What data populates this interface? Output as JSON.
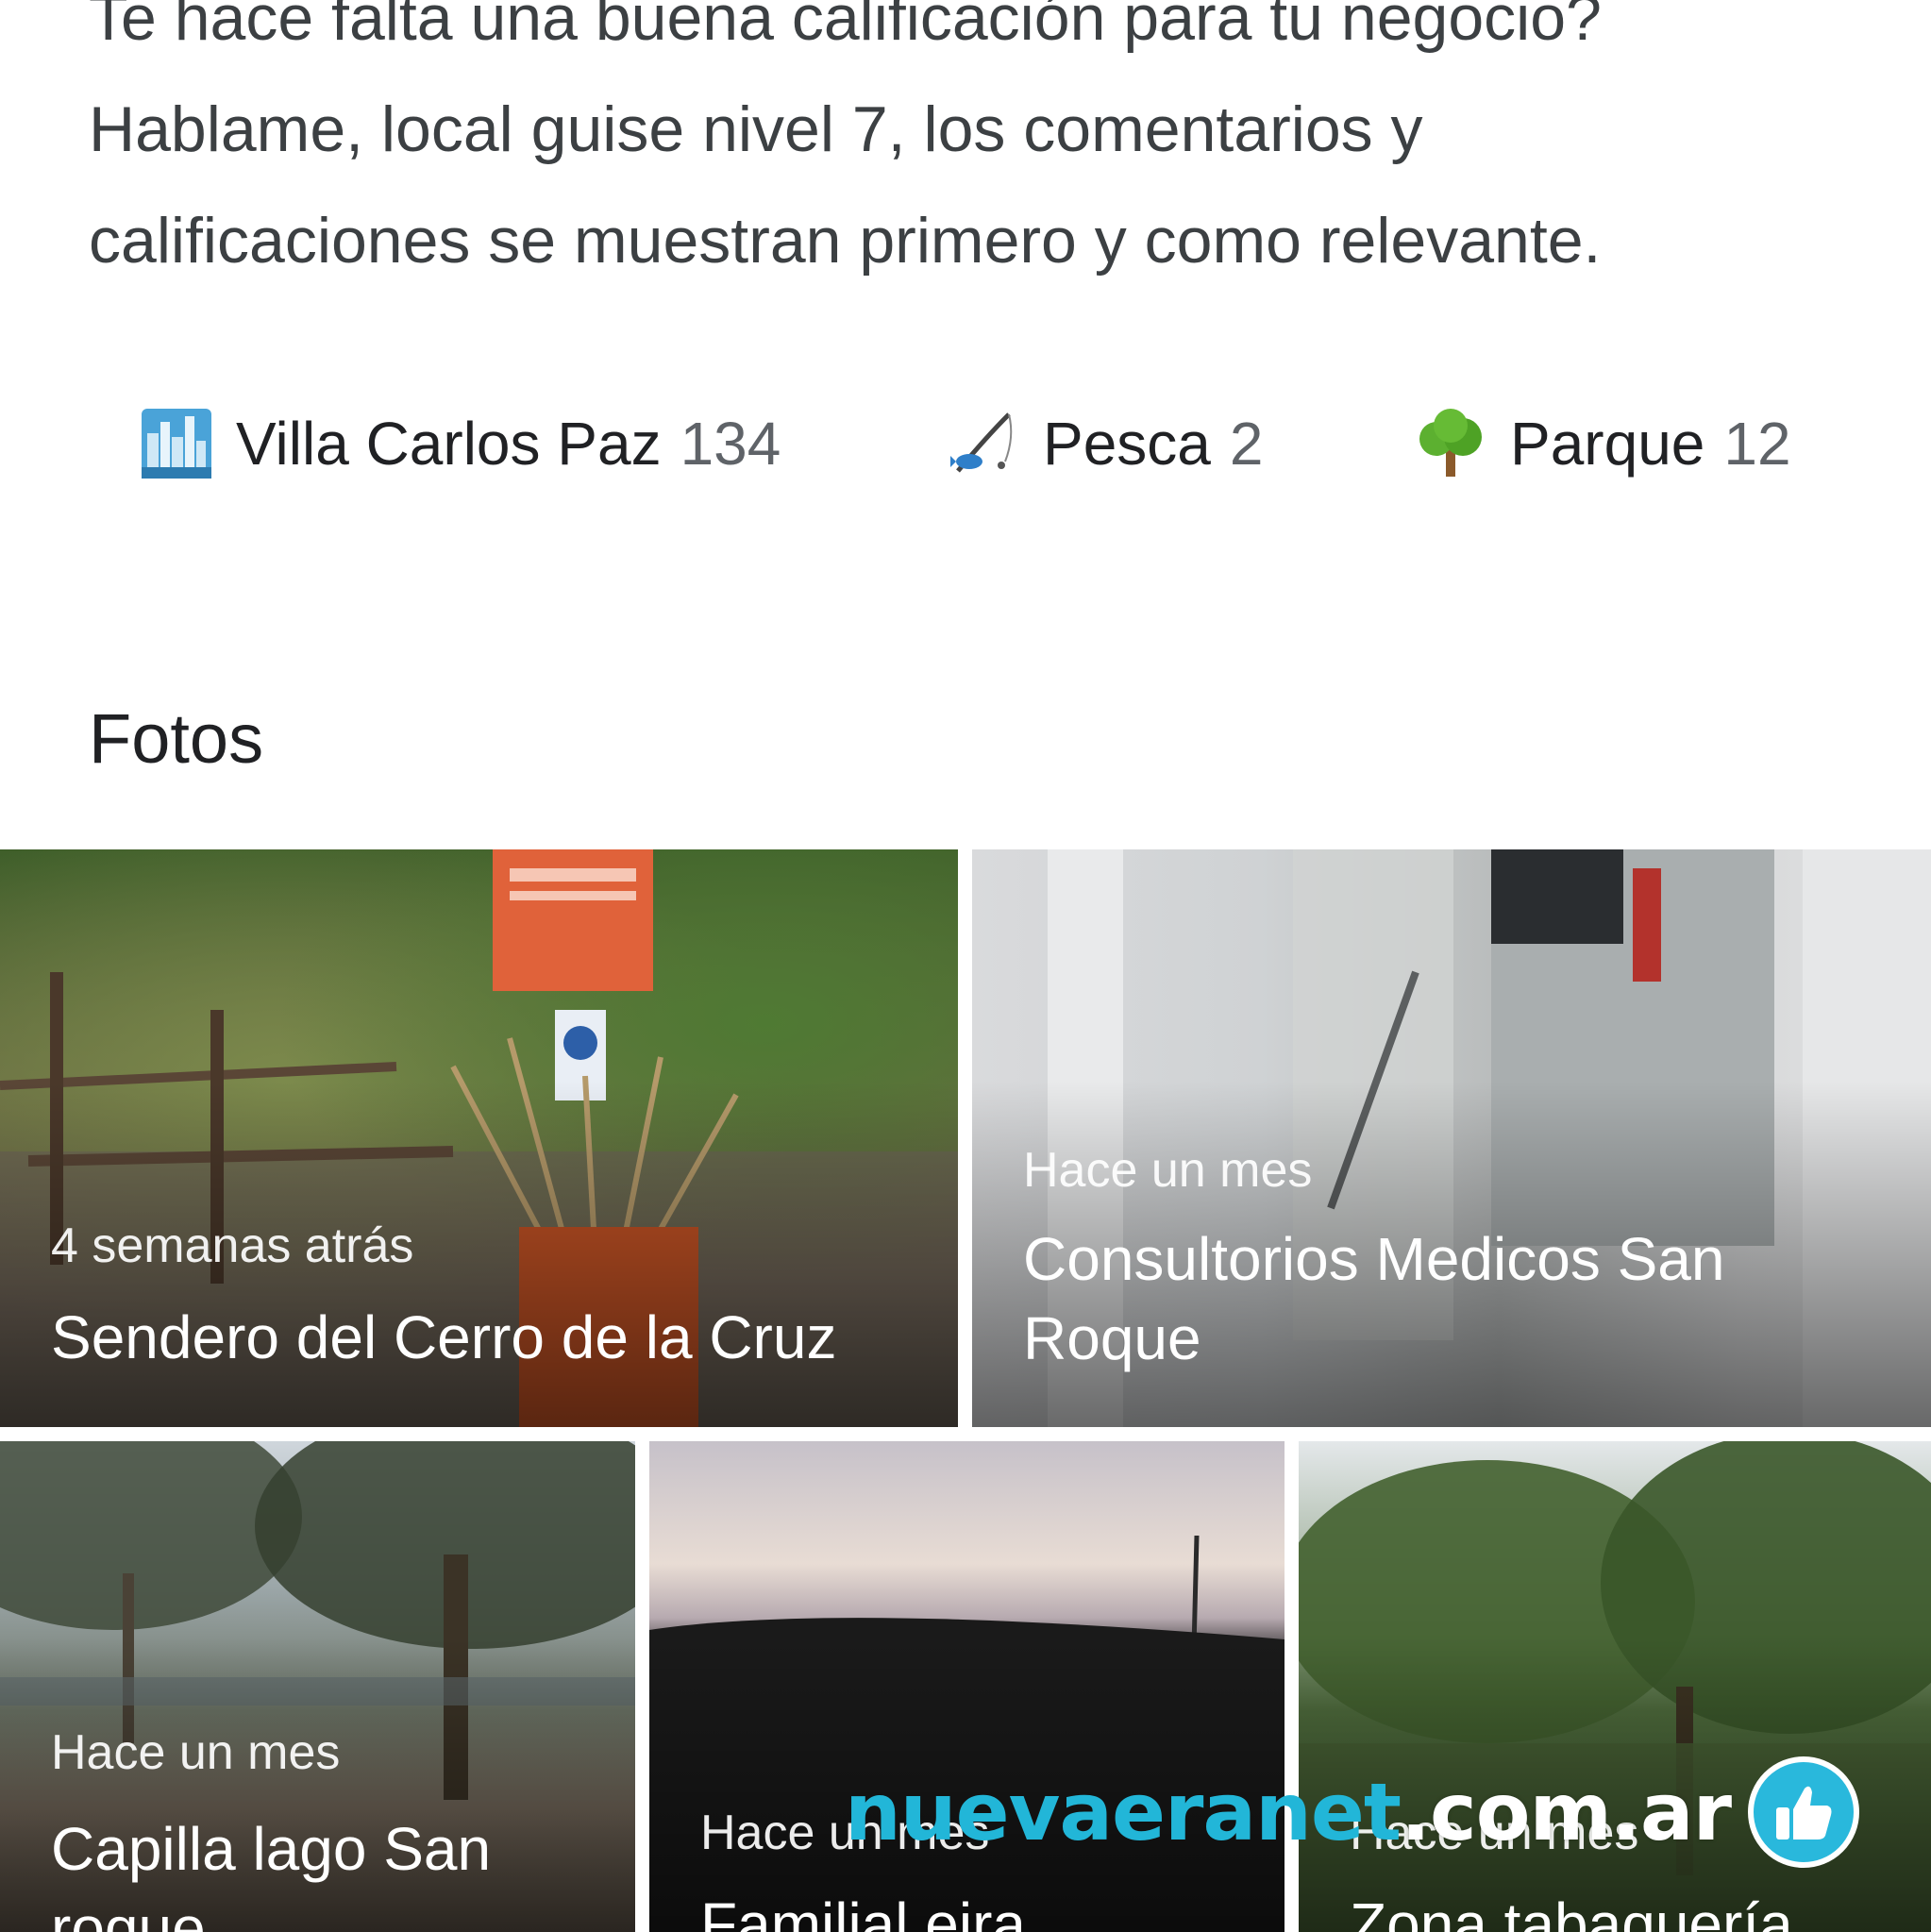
{
  "intro": {
    "line1": "Te hace falta una buena calificación para tu negocio?",
    "line2": "Hablame, local guise nivel 7, los comentarios y",
    "line3": "calificaciones se muestran primero y como relevante."
  },
  "tags": [
    {
      "icon": "cityscape-icon",
      "name": "Villa Carlos Paz",
      "count": "134"
    },
    {
      "icon": "fishing-pole-icon",
      "name": "Pesca",
      "count": "2"
    },
    {
      "icon": "tree-icon",
      "name": "Parque",
      "count": "12"
    }
  ],
  "photos_section": {
    "title": "Fotos",
    "items": [
      {
        "time": "4 semanas atrás",
        "title": "Sendero del Cerro de la Cruz"
      },
      {
        "time": "Hace un mes",
        "title": "Consultorios Medicos San Roque"
      },
      {
        "time": "Hace un mes",
        "title": "Capilla lago San roque"
      },
      {
        "time": "Hace un mes",
        "title": "Familial eira"
      },
      {
        "time": "Hace un mes",
        "title": "Zona tabaquería"
      }
    ]
  },
  "watermark": {
    "part1": "nuevaeranet",
    "part2": ".com.ar",
    "icon": "thumbs-up-icon",
    "colors": {
      "blue": "#22b6d8",
      "white": "#ffffff"
    }
  }
}
